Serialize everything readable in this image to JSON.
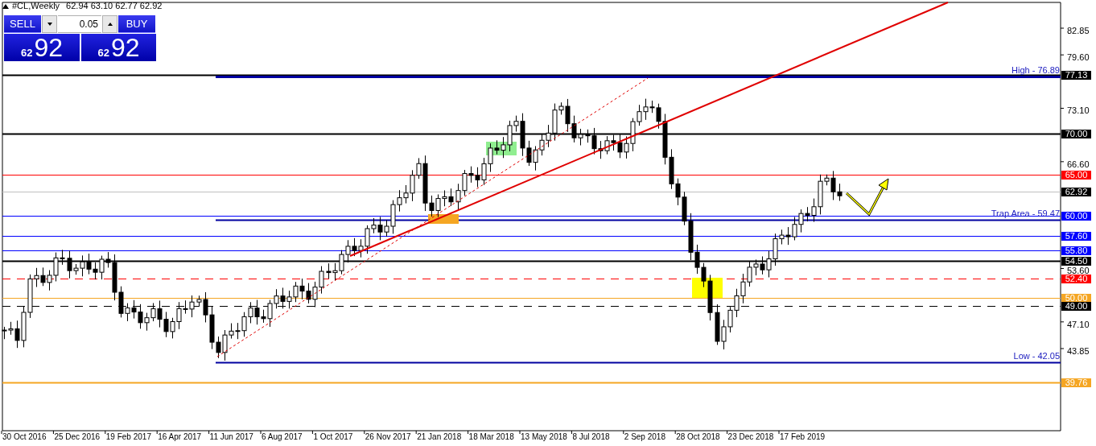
{
  "chart_header": {
    "symbol": "#CL,Weekly",
    "ohlc": "62.94 63.10 62.77 62.92"
  },
  "trade_panel": {
    "sell_label": "SELL",
    "buy_label": "BUY",
    "lot": "0.05",
    "sell_price": {
      "big_figure": "62",
      "points": "92"
    },
    "buy_price": {
      "big_figure": "62",
      "points": "92"
    }
  },
  "price_axis": {
    "ticks": [
      "82.85",
      "79.60",
      "73.10",
      "66.60",
      "53.60",
      "47.10",
      "43.85"
    ]
  },
  "levels": [
    {
      "tag": "77.13",
      "color": "#000000",
      "kind": "thick"
    },
    {
      "tag": "70.00",
      "color": "#000000",
      "kind": "thick"
    },
    {
      "tag": "65.00",
      "color": "#ff0000",
      "kind": "solid"
    },
    {
      "tag": "62.92",
      "color": "#000000",
      "kind": "current"
    },
    {
      "tag": "60.00",
      "color": "#0000ff",
      "kind": "solid"
    },
    {
      "tag": "57.60",
      "color": "#0000ff",
      "kind": "solid"
    },
    {
      "tag": "55.80",
      "color": "#0000ff",
      "kind": "solid"
    },
    {
      "tag": "54.50",
      "color": "#000000",
      "kind": "thick"
    },
    {
      "tag": "52.40",
      "color": "#ff0000",
      "kind": "dashed"
    },
    {
      "tag": "50.00",
      "color": "#f5a623",
      "kind": "solid"
    },
    {
      "tag": "49.00",
      "color": "#000000",
      "kind": "dashed"
    },
    {
      "tag": "39.76",
      "color": "#f5a623",
      "kind": "thick"
    }
  ],
  "marked_levels": [
    {
      "label": "High - 76.89"
    },
    {
      "label": "Trap Area - 59.47"
    },
    {
      "label": "Low - 42.05"
    }
  ],
  "time_axis": {
    "labels": [
      "30 Oct 2016",
      "25 Dec 2016",
      "19 Feb 2017",
      "16 Apr 2017",
      "11 Jun 2017",
      "6 Aug 2017",
      "1 Oct 2017",
      "26 Nov 2017",
      "21 Jan 2018",
      "18 Mar 2018",
      "13 May 2018",
      "8 Jul 2018",
      "2 Sep 2018",
      "28 Oct 2018",
      "23 Dec 2018",
      "17 Feb 2019"
    ]
  }
}
